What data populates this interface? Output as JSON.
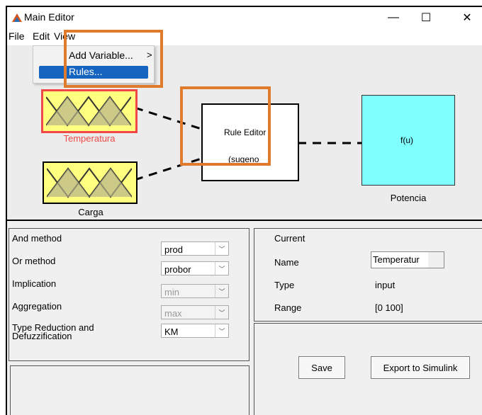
{
  "window": {
    "title": "Main Editor",
    "minimize": "—",
    "maximize": "☐",
    "close": "✕"
  },
  "menubar": {
    "file": "File",
    "edit": "Edit",
    "view": "View"
  },
  "edit_menu": {
    "items": [
      {
        "label": "Add Variable...",
        "arrow": ">"
      },
      {
        "label": "Rules..."
      }
    ]
  },
  "diagram": {
    "input1": "Temperatura",
    "input2": "Carga",
    "rule_title": "Rule Editor",
    "rule_type": "(sugeno",
    "output_fn": "f(u)",
    "output_name": "Potencia"
  },
  "left_panel": {
    "and_label": "And method",
    "and_value": "prod",
    "or_label": "Or method",
    "or_value": "probor",
    "impl_label": "Implication",
    "impl_value": "min",
    "agg_label": "Aggregation",
    "agg_value": "max",
    "tr_label_1": "Type Reduction and",
    "tr_label_2": "Defuzzification",
    "tr_value": "KM"
  },
  "right_panel": {
    "current_label": "Current",
    "name_label": "Name",
    "name_value": "Temperatur",
    "type_label": "Type",
    "type_value": "input",
    "range_label": "Range",
    "range_value": "[0 100]"
  },
  "buttons": {
    "save": "Save",
    "export": "Export to Simulink"
  },
  "colors": {
    "input_fill": "#ffff80",
    "output_fill": "#80ffff",
    "highlight_red": "#f04848",
    "annotation_orange": "#e07b2e",
    "menu_selected": "#1565c0"
  }
}
